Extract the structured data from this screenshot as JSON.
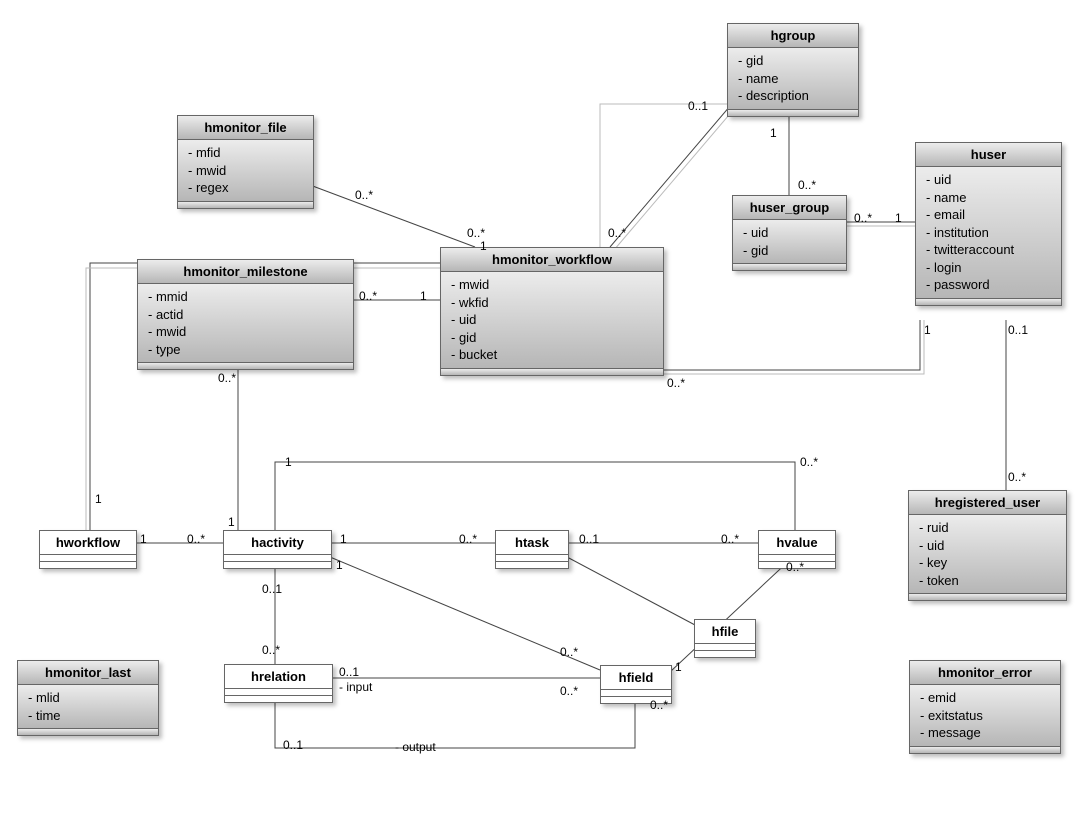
{
  "classes": {
    "hgroup": {
      "title": "hgroup",
      "attrs": [
        "gid",
        "name",
        "description"
      ]
    },
    "hmonitor_file": {
      "title": "hmonitor_file",
      "attrs": [
        "mfid",
        "mwid",
        "regex"
      ]
    },
    "huser": {
      "title": "huser",
      "attrs": [
        "uid",
        "name",
        "email",
        "institution",
        "twitteraccount",
        "login",
        "password"
      ]
    },
    "huser_group": {
      "title": "huser_group",
      "attrs": [
        "uid",
        "gid"
      ]
    },
    "hmonitor_milestone": {
      "title": "hmonitor_milestone",
      "attrs": [
        "mmid",
        "actid",
        "mwid",
        "type"
      ]
    },
    "hmonitor_workflow": {
      "title": "hmonitor_workflow",
      "attrs": [
        "mwid",
        "wkfid",
        "uid",
        "gid",
        "bucket"
      ]
    },
    "hregistered_user": {
      "title": "hregistered_user",
      "attrs": [
        "ruid",
        "uid",
        "key",
        "token"
      ]
    },
    "hworkflow": {
      "title": "hworkflow"
    },
    "hactivity": {
      "title": "hactivity"
    },
    "htask": {
      "title": "htask"
    },
    "hvalue": {
      "title": "hvalue"
    },
    "hfile": {
      "title": "hfile"
    },
    "hrelation": {
      "title": "hrelation"
    },
    "hfield": {
      "title": "hfield"
    },
    "hmonitor_last": {
      "title": "hmonitor_last",
      "attrs": [
        "mlid",
        "time"
      ]
    },
    "hmonitor_error": {
      "title": "hmonitor_error",
      "attrs": [
        "emid",
        "exitstatus",
        "message"
      ]
    }
  },
  "cards": {
    "one": "1",
    "zero_one": "0..1",
    "zero_many": "0..*"
  },
  "roles": {
    "input": "- input",
    "output": "- output"
  }
}
